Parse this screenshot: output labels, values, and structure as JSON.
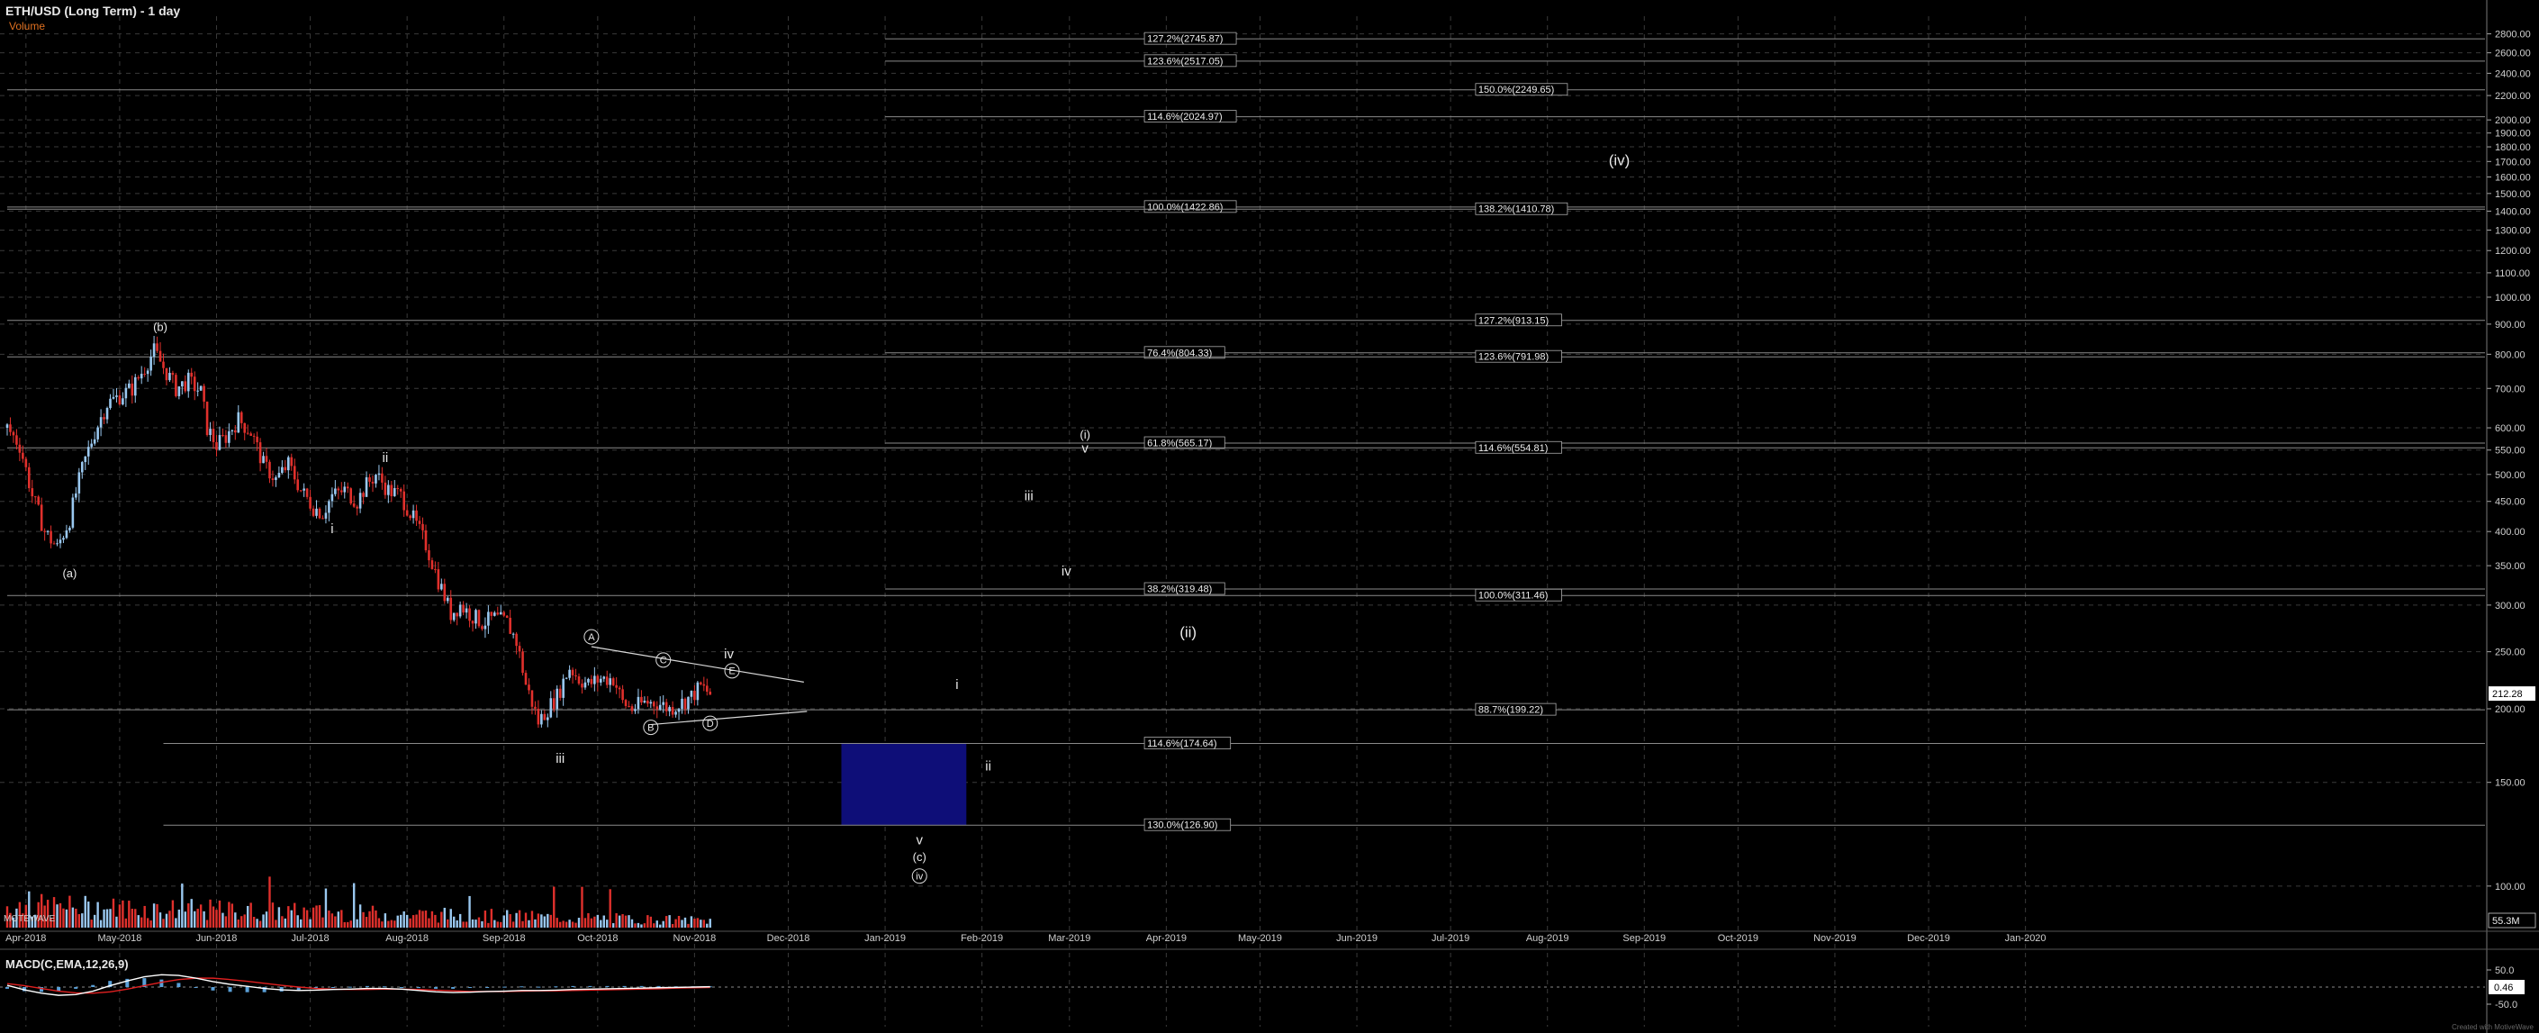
{
  "header": {
    "title": "ETH/USD (Long Term) - 1 day",
    "volume_label": "Volume",
    "macd_label": "MACD(C,EMA,12,26,9)",
    "cap_label": "MOTEWAVE",
    "watermark": "Created with MotiveWave"
  },
  "colors": {
    "background": "#000000",
    "grid": "#3a3a3a",
    "up_candle": "#9ac8f0",
    "down_candle": "#e0302c",
    "fib_line": "#8a8a8a",
    "target_box": "#0e0e78",
    "macd_line": "#ffffff",
    "signal_line": "#e02020",
    "histogram": "#5aa0d8"
  },
  "chart_data": [
    {
      "type": "candlestick",
      "title": "ETH/USD (Long Term) - 1 day",
      "y_scale": "log",
      "ylim": [
        85,
        3000
      ],
      "y_ticks": [
        {
          "value": 2800,
          "label": "2800.00"
        },
        {
          "value": 2600,
          "label": "2600.00"
        },
        {
          "value": 2400,
          "label": "2400.00"
        },
        {
          "value": 2200,
          "label": "2200.00"
        },
        {
          "value": 2000,
          "label": "2000.00"
        },
        {
          "value": 1900,
          "label": "1900.00"
        },
        {
          "value": 1800,
          "label": "1800.00"
        },
        {
          "value": 1700,
          "label": "1700.00"
        },
        {
          "value": 1600,
          "label": "1600.00"
        },
        {
          "value": 1500,
          "label": "1500.00"
        },
        {
          "value": 1400,
          "label": "1400.00"
        },
        {
          "value": 1300,
          "label": "1300.00"
        },
        {
          "value": 1200,
          "label": "1200.00"
        },
        {
          "value": 1100,
          "label": "1100.00"
        },
        {
          "value": 1000,
          "label": "1000.00"
        },
        {
          "value": 900,
          "label": "900.00"
        },
        {
          "value": 800,
          "label": "800.00"
        },
        {
          "value": 700,
          "label": "700.00"
        },
        {
          "value": 600,
          "label": "600.00"
        },
        {
          "value": 550,
          "label": "550.00"
        },
        {
          "value": 500,
          "label": "500.00"
        },
        {
          "value": 450,
          "label": "450.00"
        },
        {
          "value": 400,
          "label": "400.00"
        },
        {
          "value": 350,
          "label": "350.00"
        },
        {
          "value": 300,
          "label": "300.00"
        },
        {
          "value": 250,
          "label": "250.00"
        },
        {
          "value": 200,
          "label": "200.00"
        },
        {
          "value": 150,
          "label": "150.00"
        },
        {
          "value": 100,
          "label": "100.00"
        }
      ],
      "current_price": {
        "value": 212.28,
        "label": "212.28"
      },
      "x_ticks": [
        {
          "day": 6,
          "label": "Apr-2018"
        },
        {
          "day": 36,
          "label": "May-2018"
        },
        {
          "day": 67,
          "label": "Jun-2018"
        },
        {
          "day": 97,
          "label": "Jul-2018"
        },
        {
          "day": 128,
          "label": "Aug-2018"
        },
        {
          "day": 159,
          "label": "Sep-2018"
        },
        {
          "day": 189,
          "label": "Oct-2018"
        },
        {
          "day": 220,
          "label": "Nov-2018"
        },
        {
          "day": 250,
          "label": "Dec-2018"
        },
        {
          "day": 281,
          "label": "Jan-2019"
        },
        {
          "day": 312,
          "label": "Feb-2019"
        },
        {
          "day": 340,
          "label": "Mar-2019"
        },
        {
          "day": 371,
          "label": "Apr-2019"
        },
        {
          "day": 401,
          "label": "May-2019"
        },
        {
          "day": 432,
          "label": "Jun-2019"
        },
        {
          "day": 462,
          "label": "Jul-2019"
        },
        {
          "day": 493,
          "label": "Aug-2019"
        },
        {
          "day": 524,
          "label": "Sep-2019"
        },
        {
          "day": 554,
          "label": "Oct-2019"
        },
        {
          "day": 585,
          "label": "Nov-2019"
        },
        {
          "day": 615,
          "label": "Dec-2019"
        },
        {
          "day": 646,
          "label": "Jan-2020"
        }
      ],
      "price_path": [
        {
          "day": 0,
          "price": 600
        },
        {
          "day": 4,
          "price": 560
        },
        {
          "day": 8,
          "price": 460
        },
        {
          "day": 12,
          "price": 400
        },
        {
          "day": 16,
          "price": 375
        },
        {
          "day": 20,
          "price": 420
        },
        {
          "day": 24,
          "price": 510
        },
        {
          "day": 28,
          "price": 590
        },
        {
          "day": 32,
          "price": 660
        },
        {
          "day": 36,
          "price": 680
        },
        {
          "day": 40,
          "price": 700
        },
        {
          "day": 44,
          "price": 760
        },
        {
          "day": 47,
          "price": 810
        },
        {
          "day": 50,
          "price": 760
        },
        {
          "day": 54,
          "price": 700
        },
        {
          "day": 58,
          "price": 720
        },
        {
          "day": 62,
          "price": 690
        },
        {
          "day": 64,
          "price": 600
        },
        {
          "day": 67,
          "price": 560
        },
        {
          "day": 70,
          "price": 580
        },
        {
          "day": 74,
          "price": 620
        },
        {
          "day": 78,
          "price": 590
        },
        {
          "day": 82,
          "price": 520
        },
        {
          "day": 86,
          "price": 490
        },
        {
          "day": 90,
          "price": 520
        },
        {
          "day": 94,
          "price": 470
        },
        {
          "day": 98,
          "price": 440
        },
        {
          "day": 101,
          "price": 430
        },
        {
          "day": 104,
          "price": 460
        },
        {
          "day": 108,
          "price": 470
        },
        {
          "day": 112,
          "price": 450
        },
        {
          "day": 115,
          "price": 480
        },
        {
          "day": 118,
          "price": 500
        },
        {
          "day": 122,
          "price": 470
        },
        {
          "day": 126,
          "price": 460
        },
        {
          "day": 130,
          "price": 420
        },
        {
          "day": 134,
          "price": 380
        },
        {
          "day": 138,
          "price": 330
        },
        {
          "day": 142,
          "price": 290
        },
        {
          "day": 145,
          "price": 300
        },
        {
          "day": 148,
          "price": 290
        },
        {
          "day": 152,
          "price": 280
        },
        {
          "day": 156,
          "price": 285
        },
        {
          "day": 160,
          "price": 280
        },
        {
          "day": 163,
          "price": 260
        },
        {
          "day": 166,
          "price": 220
        },
        {
          "day": 170,
          "price": 190
        },
        {
          "day": 173,
          "price": 200
        },
        {
          "day": 176,
          "price": 210
        },
        {
          "day": 180,
          "price": 235
        },
        {
          "day": 183,
          "price": 225
        },
        {
          "day": 186,
          "price": 220
        },
        {
          "day": 190,
          "price": 225
        },
        {
          "day": 194,
          "price": 225
        },
        {
          "day": 197,
          "price": 205
        },
        {
          "day": 200,
          "price": 200
        },
        {
          "day": 204,
          "price": 205
        },
        {
          "day": 208,
          "price": 205
        },
        {
          "day": 212,
          "price": 200
        },
        {
          "day": 216,
          "price": 205
        },
        {
          "day": 219,
          "price": 210
        },
        {
          "day": 222,
          "price": 218
        },
        {
          "day": 225,
          "price": 212
        }
      ],
      "fib_levels": [
        {
          "label": "127.2%(2745.87)",
          "value": 2745.87,
          "day_start": 281,
          "label_day": 364
        },
        {
          "label": "123.6%(2517.05)",
          "value": 2517.05,
          "day_start": 281,
          "label_day": 364
        },
        {
          "label": "114.6%(2024.97)",
          "value": 2024.97,
          "day_start": 281,
          "label_day": 364
        },
        {
          "label": "100.0%(1422.86)",
          "value": 1422.86,
          "day_start": 0,
          "label_day": 364
        },
        {
          "label": "76.4%(804.33)",
          "value": 804.33,
          "day_start": 281,
          "label_day": 364
        },
        {
          "label": "61.8%(565.17)",
          "value": 565.17,
          "day_start": 281,
          "label_day": 364
        },
        {
          "label": "38.2%(319.48)",
          "value": 319.48,
          "day_start": 281,
          "label_day": 364
        },
        {
          "label": "114.6%(174.64)",
          "value": 174.64,
          "day_start": 50,
          "label_day": 364
        },
        {
          "label": "130.0%(126.90)",
          "value": 126.9,
          "day_start": 50,
          "label_day": 364
        },
        {
          "label": "150.0%(2249.65)",
          "value": 2249.65,
          "day_start": 0,
          "label_day": 470
        },
        {
          "label": "138.2%(1410.78)",
          "value": 1410.78,
          "day_start": 0,
          "label_day": 470
        },
        {
          "label": "127.2%(913.15)",
          "value": 913.15,
          "day_start": 0,
          "label_day": 470
        },
        {
          "label": "123.6%(791.98)",
          "value": 791.98,
          "day_start": 0,
          "label_day": 470
        },
        {
          "label": "114.6%(554.81)",
          "value": 554.81,
          "day_start": 0,
          "label_day": 470
        },
        {
          "label": "100.0%(311.46)",
          "value": 311.46,
          "day_start": 0,
          "label_day": 470
        },
        {
          "label": "88.7%(199.22)",
          "value": 199.22,
          "day_start": 0,
          "label_day": 470
        }
      ],
      "target_box": {
        "day_start": 267,
        "day_end": 307,
        "price_low": 127,
        "price_high": 175
      },
      "triangle_lines": [
        {
          "from": {
            "day": 187,
            "price": 255
          },
          "to": {
            "day": 255,
            "price": 222
          }
        },
        {
          "from": {
            "day": 206,
            "price": 188
          },
          "to": {
            "day": 256,
            "price": 198
          }
        }
      ],
      "wave_labels": [
        {
          "text": "(a)",
          "day": 20,
          "price": 340,
          "circled": false
        },
        {
          "text": "(b)",
          "day": 49,
          "price": 890,
          "circled": false
        },
        {
          "text": "i",
          "day": 104,
          "price": 405,
          "circled": false
        },
        {
          "text": "ii",
          "day": 121,
          "price": 535,
          "circled": false
        },
        {
          "text": "iii",
          "day": 177,
          "price": 165,
          "circled": false
        },
        {
          "text": "A",
          "day": 187,
          "price": 265,
          "circled": true
        },
        {
          "text": "B",
          "day": 206,
          "price": 186,
          "circled": true
        },
        {
          "text": "C",
          "day": 210,
          "price": 242,
          "circled": true
        },
        {
          "text": "D",
          "day": 225,
          "price": 189,
          "circled": true
        },
        {
          "text": "iv",
          "day": 231,
          "price": 248,
          "circled": false
        },
        {
          "text": "E",
          "day": 232,
          "price": 232,
          "circled": true
        },
        {
          "text": "v",
          "day": 292,
          "price": 120,
          "circled": false
        },
        {
          "text": "(c)",
          "day": 292,
          "price": 112,
          "circled": false
        },
        {
          "text": "iv",
          "day": 292,
          "price": 104,
          "circled": true
        },
        {
          "text": "i",
          "day": 304,
          "price": 220,
          "circled": false
        },
        {
          "text": "ii",
          "day": 314,
          "price": 160,
          "circled": false
        },
        {
          "text": "iii",
          "day": 327,
          "price": 460,
          "circled": false
        },
        {
          "text": "iv",
          "day": 339,
          "price": 343,
          "circled": false
        },
        {
          "text": "(i)",
          "day": 345,
          "price": 585,
          "circled": false
        },
        {
          "text": "v",
          "day": 345,
          "price": 555,
          "circled": false
        },
        {
          "text": "(ii)",
          "day": 378,
          "price": 270,
          "circled": false
        },
        {
          "text": "(iv)",
          "day": 516,
          "price": 1710,
          "circled": false
        }
      ],
      "volume": {
        "current_label": "55.3M"
      }
    },
    {
      "type": "line",
      "title": "MACD(C,EMA,12,26,9)",
      "ylim": [
        -60,
        60
      ],
      "y_ticks": [
        {
          "value": 50,
          "label": "50.0"
        },
        {
          "value": -50,
          "label": "-50.0"
        }
      ],
      "current_value": {
        "value": 0.46,
        "label": "0.46"
      },
      "series": [
        {
          "values": [
            5,
            -8,
            -18,
            -24,
            -22,
            -12,
            4,
            18,
            30,
            36,
            34,
            26,
            16,
            8,
            2,
            -4,
            -8,
            -10,
            -9,
            -7,
            -6,
            -4,
            -4,
            -6,
            -10,
            -14,
            -16,
            -15,
            -13,
            -12,
            -10,
            -10,
            -9,
            -7,
            -6,
            -5,
            -4,
            -3,
            -2,
            -1,
            0,
            1
          ]
        },
        {
          "values": [
            10,
            4,
            -4,
            -12,
            -17,
            -18,
            -14,
            -6,
            4,
            14,
            22,
            26,
            26,
            22,
            17,
            11,
            5,
            0,
            -4,
            -6,
            -7,
            -7,
            -6,
            -6,
            -7,
            -9,
            -11,
            -13,
            -13,
            -13,
            -12,
            -11,
            -11,
            -10,
            -9,
            -8,
            -7,
            -6,
            -5,
            -3,
            -2,
            -1
          ]
        }
      ]
    }
  ]
}
